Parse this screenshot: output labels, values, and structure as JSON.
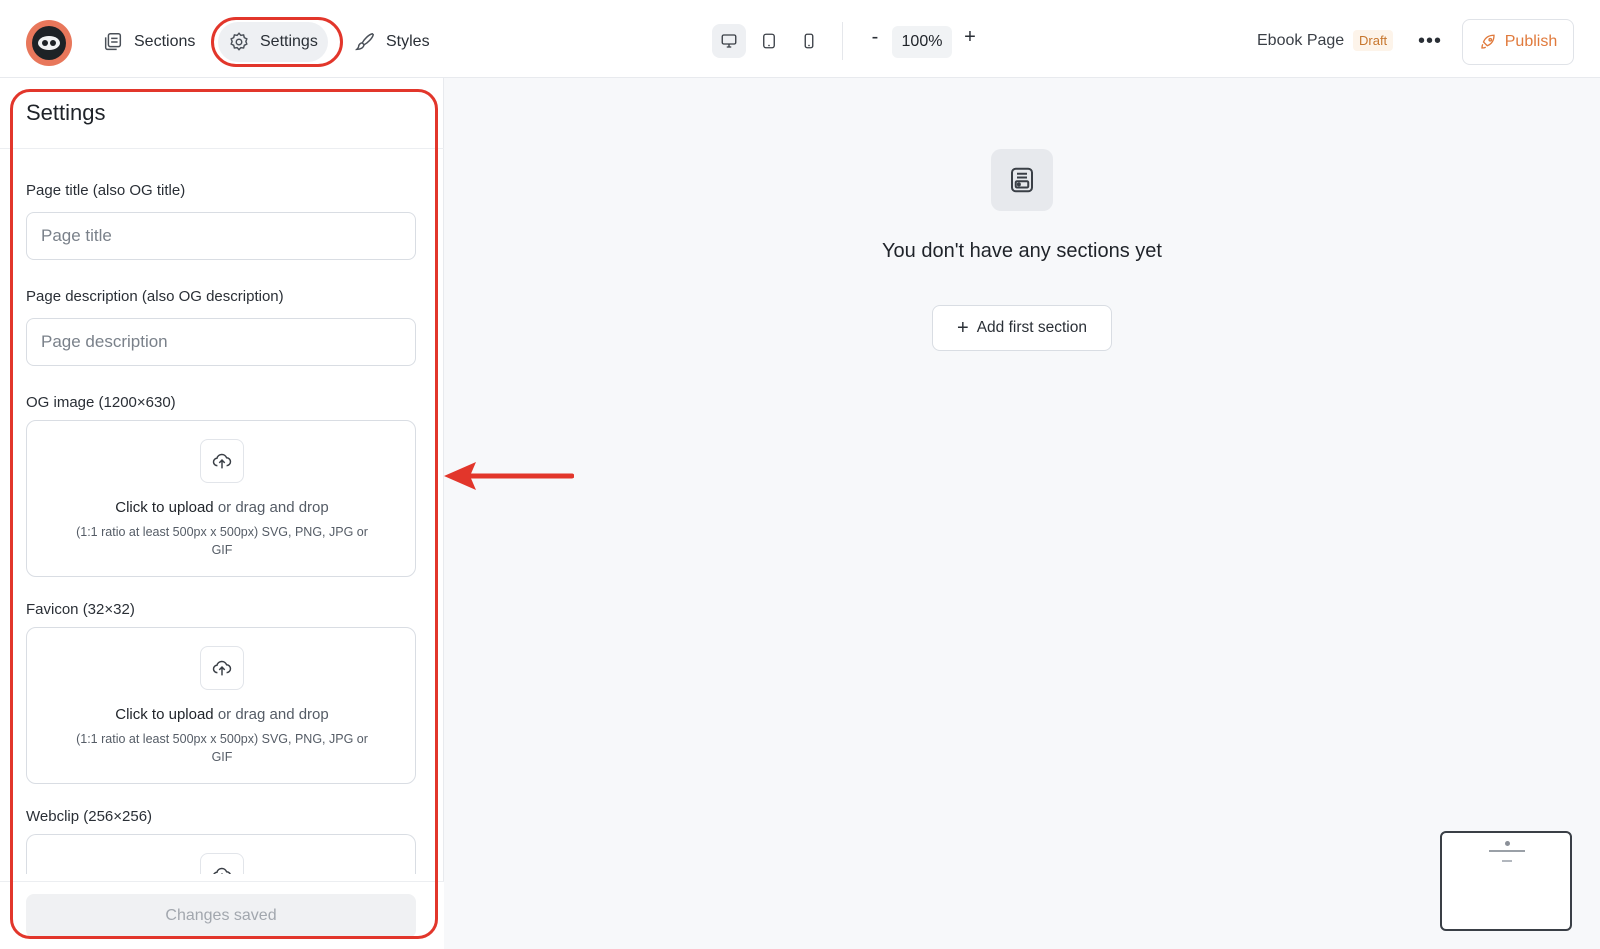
{
  "topbar": {
    "nav": [
      {
        "label": "Sections",
        "icon": "sections-icon"
      },
      {
        "label": "Settings",
        "icon": "gear-icon"
      },
      {
        "label": "Styles",
        "icon": "brush-icon"
      }
    ],
    "zoom": {
      "minus": "-",
      "value": "100%",
      "plus": "+"
    },
    "page_name": "Ebook Page",
    "status": "Draft",
    "more": "•••",
    "publish_label": "Publish"
  },
  "panel": {
    "title": "Settings",
    "page_title_label": "Page title (also OG title)",
    "page_title_placeholder": "Page title",
    "page_description_label": "Page description (also OG description)",
    "page_description_placeholder": "Page description",
    "og_image_label": "OG image (1200×630)",
    "favicon_label": "Favicon (32×32)",
    "webclip_label": "Webclip (256×256)",
    "upload": {
      "action": "Click to upload",
      "rest": " or drag and drop",
      "hint": "(1:1 ratio at least 500px x 500px) SVG, PNG, JPG or GIF"
    },
    "footer_button": "Changes saved"
  },
  "canvas": {
    "empty_text": "You don't have any sections yet",
    "add_button": "Add first section"
  },
  "colors": {
    "callout": "#e2362b",
    "accent": "#e07a3c",
    "logo_bg": "#e8775b"
  }
}
